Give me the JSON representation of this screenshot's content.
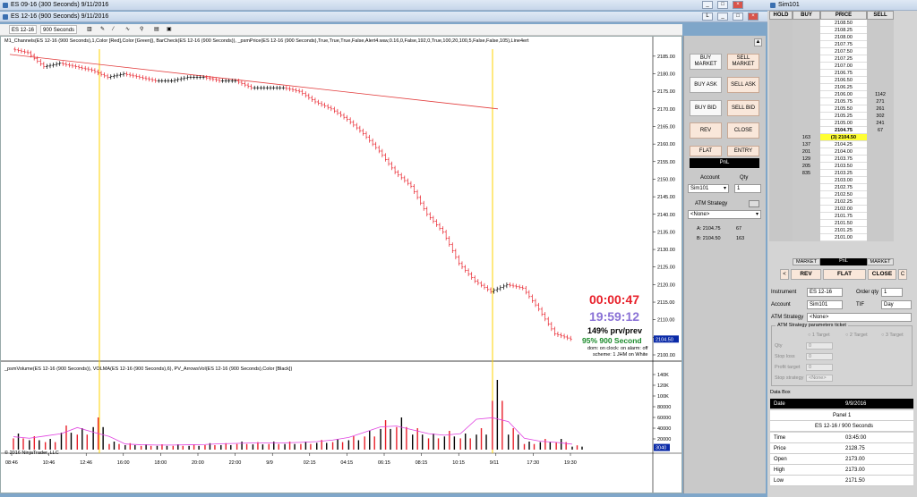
{
  "windows": {
    "back_title": "ES 09-16 (300 Seconds)  9/11/2016",
    "front_title": "ES 12-16 (900 Seconds)  9/11/2016",
    "dom_title": "Sim101"
  },
  "toolbar": {
    "instrument": "ES 12-16",
    "interval": "900 Seconds"
  },
  "chart": {
    "price_indicator_label": "M1_Channels(ES 12-16 (900 Seconds),1,Color [Red],Color [Green]), BarCheck(ES 12-16 (900 Seconds)), _psmPrice(ES 12-16 (900 Seconds),True,True,True,False,Alert4.wav,0.16,0,False,192,0,True,100,20,100,5,False,False,105),Line4ert",
    "volume_indicator_label": "_psmVolume(ES 12-16 (900 Seconds)), VOLMA(ES 12-16 (900 Seconds),6), PV_ArrowsVol(ES 12-16 (900 Seconds),Color [Black])",
    "copyright": "© 2016 NinjaTrader, LLC",
    "price_ticks": [
      "2185.00",
      "2180.00",
      "2175.00",
      "2170.00",
      "2165.00",
      "2160.00",
      "2155.00",
      "2150.00",
      "2145.00",
      "2140.00",
      "2135.00",
      "2130.00",
      "2125.00",
      "2120.00",
      "2115.00",
      "2110.00",
      "2105.00",
      "2100.00"
    ],
    "volume_ticks": [
      "140K",
      "120K",
      "100K",
      "80000",
      "60000",
      "40000",
      "20000"
    ],
    "volume_last": "3040",
    "price_last": "2104.50",
    "time_ticks": [
      "08:46",
      "10:46",
      "12:46",
      "16:00",
      "18:00",
      "20:00",
      "22:00",
      "9/9",
      "02:15",
      "04:15",
      "06:15",
      "08:15",
      "10:15",
      "9/11",
      "17:30",
      "19:30"
    ],
    "countdown": "00:00:47",
    "clock": "19:59:12",
    "ratio_text": "149% prv/prev",
    "pct_text": "95% 900 Second",
    "dom_note_1": "dom: on clock: on alarm: off",
    "dom_note_2": "scheme: 1 JHM on White",
    "colors": {
      "up": "#000000",
      "down": "#e8202a",
      "trendline": "#e23b3b",
      "vertical": "#ffd300",
      "volma": "#e040e0"
    }
  },
  "chart_data": {
    "type": "candlestick",
    "ylim": [
      2100,
      2187
    ],
    "y2": [
      2187,
      2186,
      2182,
      2183,
      2182,
      2181,
      2179,
      2180,
      2179,
      2178,
      2178,
      2179,
      2179,
      2178,
      2178,
      2176,
      2176,
      2176,
      2175,
      2172,
      2170,
      2167,
      2163,
      2158,
      2152,
      2148,
      2140,
      2135,
      2126,
      2121,
      2118,
      2120,
      2119,
      2113,
      2106,
      2104.5
    ],
    "volume": [
      30,
      25,
      20,
      45,
      40,
      60,
      15,
      12,
      10,
      10,
      10,
      10,
      12,
      12,
      15,
      14,
      15,
      15,
      15,
      18,
      20,
      25,
      35,
      55,
      60,
      40,
      30,
      35,
      30,
      40,
      130,
      40,
      15,
      20,
      20,
      8
    ],
    "volume_ylim": [
      0,
      150
    ]
  },
  "order_panel": {
    "buy_market": "BUY MARKET",
    "sell_market": "SELL MARKET",
    "buy_ask": "BUY ASK",
    "sell_ask": "SELL ASK",
    "buy_bid": "BUY BID",
    "sell_bid": "SELL BID",
    "rev": "REV",
    "close": "CLOSE",
    "flat": "FLAT",
    "entry": "ENTRY",
    "pnl": "PnL",
    "account_label": "Account",
    "qty_label": "Qty",
    "account": "Sim101",
    "qty": "1",
    "atm_label": "ATM Strategy",
    "atm_value": "<None>",
    "ask_line": "A: 2104.75",
    "ask_size": "67",
    "bid_line": "B: 2104.50",
    "bid_size": "163"
  },
  "dom": {
    "headers": [
      "HOLD",
      "BUY",
      "PRICE",
      "SELL"
    ],
    "prices": [
      "2108.50",
      "2108.25",
      "2108.00",
      "2107.75",
      "2107.50",
      "2107.25",
      "2107.00",
      "2106.75",
      "2106.50",
      "2106.25",
      "2106.00",
      "2105.75",
      "2105.50",
      "2105.25",
      "2105.00",
      "2104.75",
      "(3) 2104.50",
      "2104.25",
      "2104.00",
      "2103.75",
      "2103.50",
      "2103.25",
      "2103.00",
      "2102.75",
      "2102.50",
      "2102.25",
      "2102.00",
      "2101.75",
      "2101.50",
      "2101.25",
      "2101.00"
    ],
    "sells": [
      "",
      "",
      "",
      "",
      "",
      "",
      "",
      "",
      "",
      "",
      "1142",
      "271",
      "261",
      "302",
      "241",
      "67",
      "",
      "",
      "",
      "",
      "",
      "",
      "",
      "",
      "",
      "",
      "",
      "",
      "",
      "",
      ""
    ],
    "buys": [
      "",
      "",
      "",
      "",
      "",
      "",
      "",
      "",
      "",
      "",
      "",
      "",
      "",
      "",
      "",
      "",
      "163",
      "137",
      "201",
      "129",
      "205",
      "835",
      "",
      "",
      "",
      "",
      "",
      "",
      "",
      "",
      ""
    ],
    "footer": [
      "MARKET",
      "PnL",
      "MARKET"
    ],
    "rev": "REV",
    "flat": "FLAT",
    "close": "CLOSE",
    "left_arrow": "<",
    "right_c": "C",
    "instrument_label": "Instrument",
    "instrument": "ES 12-16",
    "order_qty_label": "Order qty",
    "order_qty": "1",
    "account_label": "Account",
    "account": "Sim101",
    "tif_label": "TIF",
    "tif": "Day",
    "atm_label": "ATM Strategy",
    "atm": "<None>",
    "atm_params": "ATM Strategy parameters ticket",
    "targets": [
      "1 Target",
      "2 Target",
      "3 Target"
    ],
    "qty_label": "Qty",
    "stop_loss": "Stop loss",
    "profit_target": "Profit target",
    "stop_strategy": "Stop strategy",
    "stop_strategy_val": "<None>",
    "zero": "0"
  },
  "databox": {
    "title": "Data Box",
    "date_label": "Date",
    "date_val": "9/9/2016",
    "panel": "Panel 1",
    "series": "ES 12-16 / 900 Seconds",
    "rows": [
      [
        "Time",
        "03:45:00"
      ],
      [
        "Price",
        "2128.75"
      ],
      [
        "Open",
        "2173.00"
      ],
      [
        "High",
        "2173.00"
      ],
      [
        "Low",
        "2171.50"
      ]
    ]
  }
}
